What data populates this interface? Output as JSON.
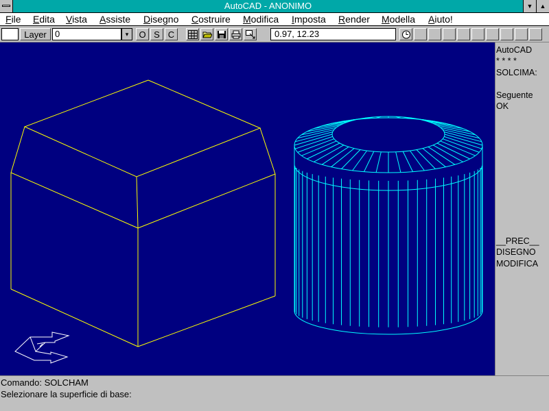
{
  "window": {
    "title": "AutoCAD - ANONIMO",
    "minimize_glyph": "▼",
    "maximize_glyph": "▲"
  },
  "menubar": {
    "items": [
      {
        "label": "File",
        "accel": "F",
        "rest": "ile"
      },
      {
        "label": "Edita",
        "accel": "E",
        "rest": "dita"
      },
      {
        "label": "Vista",
        "accel": "V",
        "rest": "ista"
      },
      {
        "label": "Assiste",
        "accel": "A",
        "rest": "ssiste"
      },
      {
        "label": "Disegno",
        "accel": "D",
        "rest": "isegno"
      },
      {
        "label": "Costruire",
        "accel": "C",
        "rest": "ostruire"
      },
      {
        "label": "Modifica",
        "accel": "M",
        "rest": "odifica"
      },
      {
        "label": "Imposta",
        "accel": "I",
        "rest": "mposta"
      },
      {
        "label": "Render",
        "accel": "R",
        "rest": "ender"
      },
      {
        "label": "Modella",
        "accel": "M",
        "rest": "odella"
      },
      {
        "label": "Aiuto!",
        "accel": "A",
        "rest": "iuto!"
      }
    ]
  },
  "toolbar": {
    "layer_label": "Layer",
    "layer_value": "0",
    "dropdown_glyph": "▾",
    "osc": [
      "O",
      "S",
      "C"
    ],
    "coordinates": "0.97, 12.23",
    "icons": [
      "grid-icon",
      "open-folder-icon",
      "save-icon",
      "print-icon",
      "zoom-window-icon"
    ],
    "clock_icon": "clock-icon"
  },
  "sidemenu": {
    "items": [
      {
        "label": "AutoCAD",
        "row": 0
      },
      {
        "label": "* * * *",
        "row": 1
      },
      {
        "label": "SOLCIMA:",
        "row": 2
      },
      {
        "label": "Seguente",
        "row": 4
      },
      {
        "label": "OK",
        "row": 5
      },
      {
        "label": "__PREC__",
        "row": 17
      },
      {
        "label": "DISEGNO",
        "row": 18
      },
      {
        "label": "MODIFICA",
        "row": 19
      }
    ]
  },
  "command": {
    "lines": [
      "Comando: SOLCHAM",
      "Selezionare la superficie di base:"
    ]
  },
  "colors": {
    "canvas_bg": "#000080",
    "box_wire": "#ffff00",
    "cylinder_wire": "#00ffff",
    "ucs_icon": "#ffffff",
    "titlebar": "#00a8a8"
  }
}
